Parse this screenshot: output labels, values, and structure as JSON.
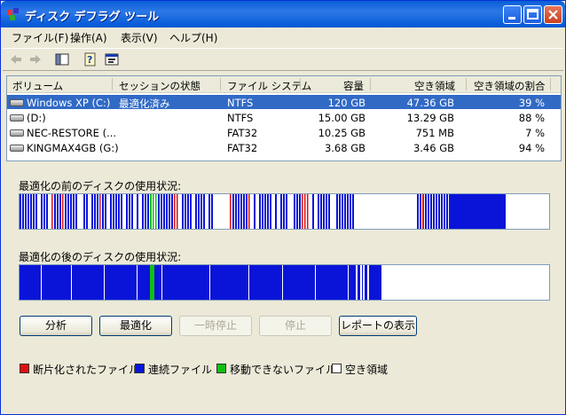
{
  "window": {
    "title": "ディスク デフラグ ツール"
  },
  "menu": [
    "ファイル(F)",
    "操作(A)",
    "表示(V)",
    "ヘルプ(H)"
  ],
  "columns": [
    "ボリューム",
    "セッションの状態",
    "ファイル システム",
    "容量",
    "空き領域",
    "空き領域の割合"
  ],
  "volumes": [
    {
      "name": "Windows XP (C:)",
      "status": "最適化済み",
      "fs": "NTFS",
      "capacity": "120 GB",
      "free": "47.36 GB",
      "pct": "39 %"
    },
    {
      "name": "(D:)",
      "status": "",
      "fs": "NTFS",
      "capacity": "15.00 GB",
      "free": "13.29 GB",
      "pct": "88 %"
    },
    {
      "name": "NEC-RESTORE (...",
      "status": "",
      "fs": "FAT32",
      "capacity": "10.25 GB",
      "free": "751 MB",
      "pct": "7 %"
    },
    {
      "name": "KINGMAX4GB (G:)",
      "status": "",
      "fs": "FAT32",
      "capacity": "3.68 GB",
      "free": "3.46 GB",
      "pct": "94 %"
    }
  ],
  "before_label": "最適化の前のディスクの使用状況:",
  "after_label": "最適化の後のディスクの使用状況:",
  "buttons": {
    "analyze": "分析",
    "defrag": "最適化",
    "pause": "一時停止",
    "stop": "停止",
    "report": "レポートの表示"
  },
  "legend": [
    {
      "label": "断片化されたファイル",
      "color": "#e01010"
    },
    {
      "label": "連続ファイル",
      "color": "#0a14d8"
    },
    {
      "label": "移動できないファイル",
      "color": "#10c010"
    },
    {
      "label": "空き領域",
      "color": "#ffffff"
    }
  ]
}
